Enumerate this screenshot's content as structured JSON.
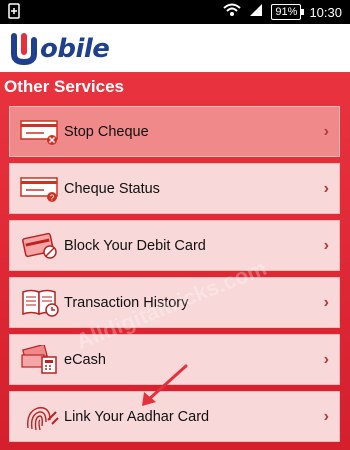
{
  "statusbar": {
    "battery": "91%",
    "time": "10:30"
  },
  "app": {
    "logo_text": "obile",
    "brand_color": "#1f3f8f",
    "accent": "#e4313d"
  },
  "section": {
    "title": "Other Services"
  },
  "items": [
    {
      "label": "Stop Cheque",
      "icon": "cheque-cancel-icon"
    },
    {
      "label": "Cheque Status",
      "icon": "cheque-status-icon"
    },
    {
      "label": "Block Your Debit Card",
      "icon": "debit-card-block-icon"
    },
    {
      "label": "Transaction History",
      "icon": "history-book-icon"
    },
    {
      "label": "eCash",
      "icon": "cash-atm-icon"
    },
    {
      "label": "Link Your Aadhar Card",
      "icon": "fingerprint-icon"
    }
  ],
  "watermark": "Alldigitaltricks.com"
}
